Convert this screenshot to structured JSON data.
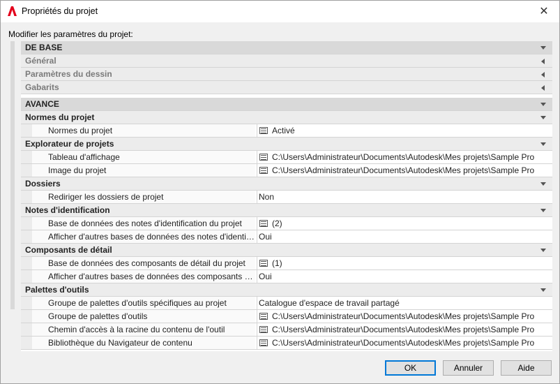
{
  "window": {
    "title": "Propriétés du projet",
    "close_glyph": "✕",
    "accent_color": "#e3001b"
  },
  "prompt": "Modifier les paramètres du projet:",
  "sections": {
    "basic": {
      "label": "DE BASE",
      "items": [
        "Général",
        "Paramètres du dessin",
        "Gabarits"
      ]
    },
    "advanced": {
      "label": "AVANCE",
      "categories": [
        {
          "label": "Normes du projet",
          "props": [
            {
              "name": "Normes du projet",
              "value": "Activé",
              "icon": true
            }
          ]
        },
        {
          "label": "Explorateur de projets",
          "props": [
            {
              "name": "Tableau d'affichage",
              "value": "C:\\Users\\Administrateur\\Documents\\Autodesk\\Mes  projets\\Sample  Pro",
              "icon": true
            },
            {
              "name": "Image du projet",
              "value": "C:\\Users\\Administrateur\\Documents\\Autodesk\\Mes  projets\\Sample  Pro",
              "icon": true
            }
          ]
        },
        {
          "label": "Dossiers",
          "props": [
            {
              "name": "Rediriger les dossiers de projet",
              "value": "Non",
              "icon": false
            }
          ]
        },
        {
          "label": "Notes d'identification",
          "props": [
            {
              "name": "Base de données des notes d'identification du projet",
              "value": "(2)",
              "icon": true
            },
            {
              "name": "Afficher d'autres bases de données des notes d'identifi...",
              "value": "Oui",
              "icon": false
            }
          ]
        },
        {
          "label": "Composants de détail",
          "props": [
            {
              "name": "Base de données des composants de détail du projet",
              "value": "(1)",
              "icon": true
            },
            {
              "name": "Afficher d'autres bases de données des composants de...",
              "value": "Oui",
              "icon": false
            }
          ]
        },
        {
          "label": "Palettes d'outils",
          "props": [
            {
              "name": "Groupe de palettes d'outils spécifiques au projet",
              "value": "Catalogue d'espace de travail partagé",
              "icon": false
            },
            {
              "name": "Groupe de palettes d'outils",
              "value": "C:\\Users\\Administrateur\\Documents\\Autodesk\\Mes  projets\\Sample  Pro",
              "icon": true
            },
            {
              "name": "Chemin d'accès à la racine du contenu de l'outil",
              "value": "C:\\Users\\Administrateur\\Documents\\Autodesk\\Mes  projets\\Sample  Pro",
              "icon": true
            },
            {
              "name": "Bibliothèque du Navigateur de contenu",
              "value": "C:\\Users\\Administrateur\\Documents\\Autodesk\\Mes  projets\\Sample  Pro",
              "icon": true
            }
          ]
        }
      ]
    }
  },
  "buttons": {
    "ok": "OK",
    "cancel": "Annuler",
    "help": "Aide"
  }
}
